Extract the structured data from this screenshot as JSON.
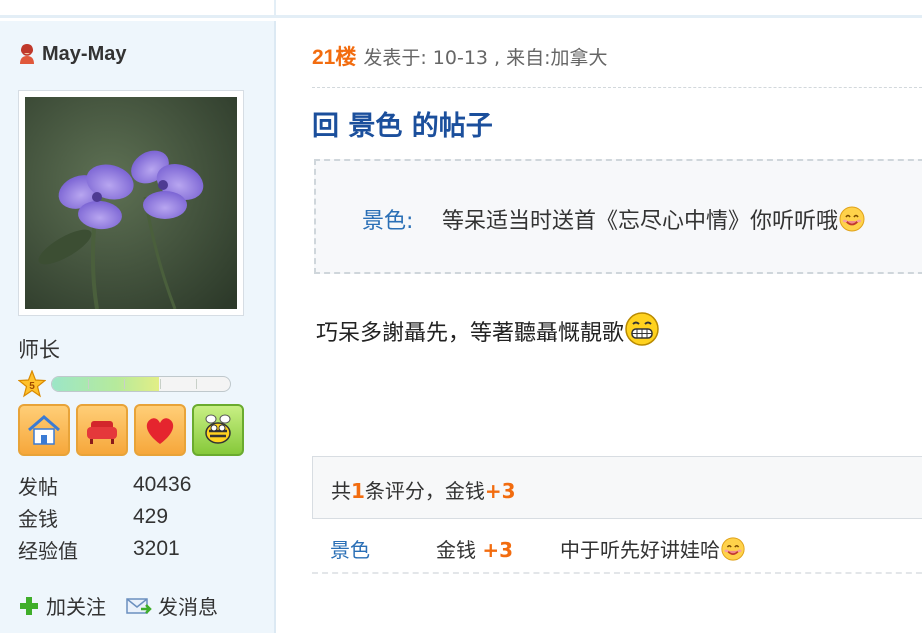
{
  "user": {
    "name": "May-May",
    "rank": "师长",
    "level_progress": 0.6,
    "stats": [
      {
        "label": "发帖",
        "value": "40436"
      },
      {
        "label": "金钱",
        "value": "429"
      },
      {
        "label": "经验值",
        "value": "3201"
      }
    ],
    "actions": {
      "follow": "加关注",
      "message": "发消息"
    },
    "medals": [
      "home-medal-icon",
      "sofa-medal-icon",
      "heart-medal-icon",
      "bee-medal-icon"
    ]
  },
  "post": {
    "floor": "21楼",
    "meta": "发表于: 10-13 , 来自:加拿大",
    "title": "回 景色 的帖子",
    "quote": {
      "author": "景色:",
      "text": "等呆适当时送首《忘尽心中情》你听听哦"
    },
    "body": "巧呆多謝聶先，等著聽聶慨靚歌"
  },
  "rating": {
    "summary_prefix": "共",
    "count": "1",
    "summary_mid": "条评分，",
    "currency": "金钱",
    "total": "+3",
    "entries": [
      {
        "user": "景色",
        "currency": "金钱",
        "amount": "+3",
        "reason": "中于听先好讲娃哈"
      }
    ]
  },
  "colors": {
    "accent_orange": "#f26c0f",
    "link_blue": "#2a6fb6",
    "title_blue": "#1b4f9c",
    "sidebar_bg": "#eef6fc"
  }
}
